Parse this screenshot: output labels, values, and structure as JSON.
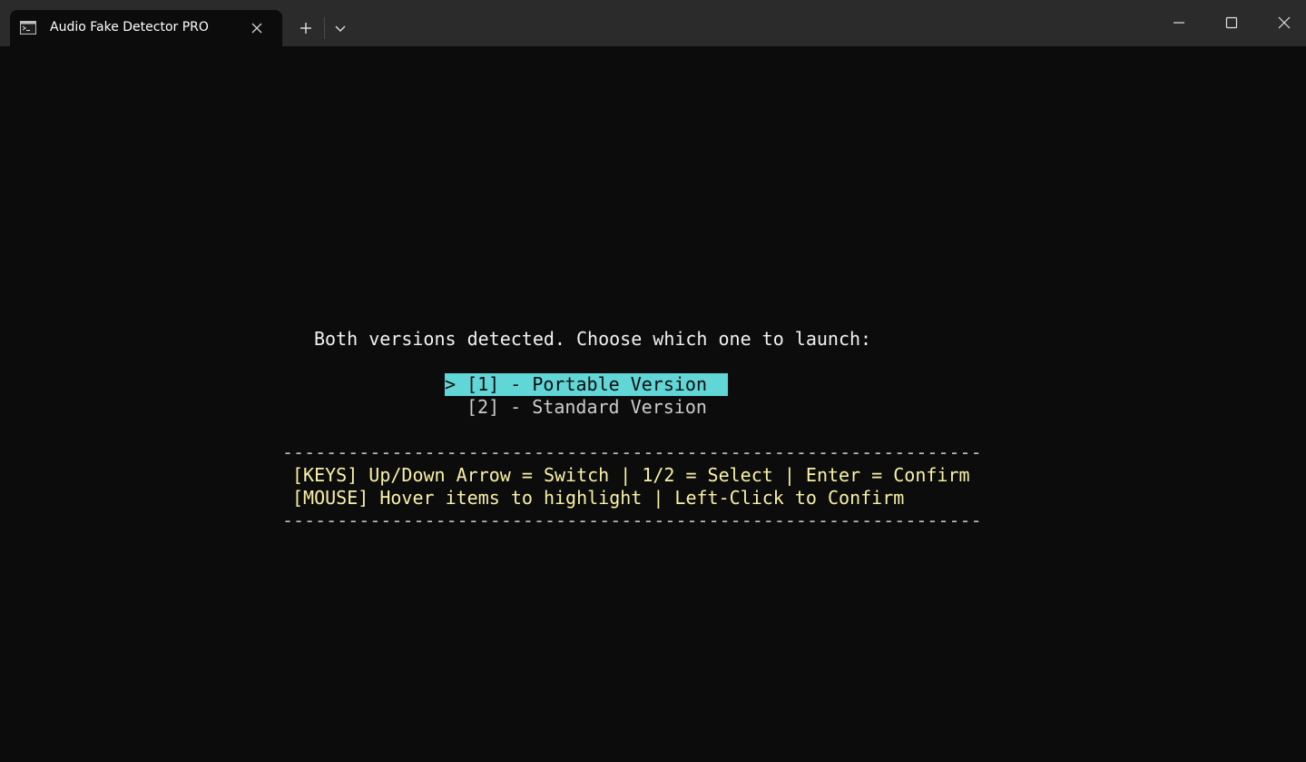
{
  "window": {
    "tab_title": "Audio Fake Detector PRO",
    "icons": {
      "tab": "terminal-icon",
      "close_tab": "close-icon",
      "new_tab": "plus-icon",
      "dropdown": "chevron-down-icon",
      "minimize": "minimize-icon",
      "maximize": "maximize-icon",
      "close_window": "close-icon"
    }
  },
  "terminal": {
    "prompt": "Both versions detected. Choose which one to launch:",
    "options": [
      {
        "label": "> [1] - Portable Version ",
        "selected": true
      },
      {
        "label": "[2] - Standard Version",
        "selected": false
      }
    ],
    "rule_top": "----------------------------------------------------------------",
    "keys_help": "[KEYS] Up/Down Arrow = Switch | 1/2 = Select | Enter = Confirm",
    "mouse_help": "[MOUSE] Hover items to highlight | Left-Click to Confirm",
    "rule_bottom": "----------------------------------------------------------------",
    "colors": {
      "background": "#0c0c0c",
      "highlight": "#61d6d6",
      "help_text": "#f9f1a5",
      "text": "#f2f2f2"
    }
  }
}
